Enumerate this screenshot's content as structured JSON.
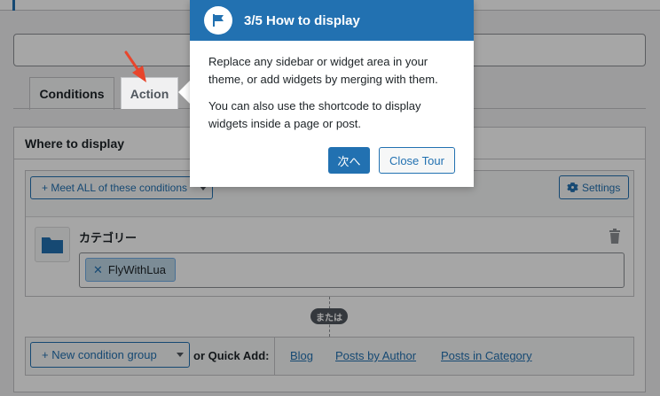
{
  "tabs": {
    "conditions": "Conditions",
    "action": "Action"
  },
  "panel": {
    "title": "Where to display"
  },
  "group": {
    "meet_label": "+ Meet ALL of these conditions",
    "settings_label": "Settings",
    "condition_label": "カテゴリー",
    "tag_value": "FlyWithLua",
    "or_label": "または"
  },
  "bottom": {
    "new_group_label": "+ New condition group",
    "quick_add_label": "or Quick Add:",
    "links": [
      "Blog",
      "Posts by Author",
      "Posts in Category"
    ]
  },
  "tour": {
    "step_title": "3/5 How to display",
    "paragraph1": "Replace any sidebar or widget area in your theme, or add widgets by merging with them.",
    "paragraph2": "You can also use the shortcode to display widgets inside a page or post.",
    "next_label": "次へ",
    "close_label": "Close Tour"
  },
  "colors": {
    "accent": "#2271b1",
    "pointer_arrow": "#e8452c"
  },
  "icons": {
    "settings": "gear-icon",
    "category": "folder-icon",
    "remove": "trash-icon",
    "tour": "flag-icon",
    "tag_remove": "close-icon",
    "pointer": "arrow-icon"
  }
}
